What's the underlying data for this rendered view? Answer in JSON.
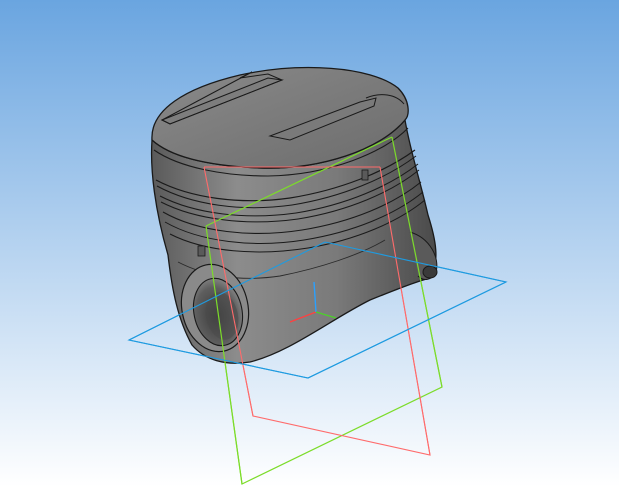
{
  "viewport": {
    "background_gradient": {
      "top": "#6aa5e0",
      "bottom": "#ffffff"
    },
    "view_mode": "shaded-with-edges"
  },
  "model": {
    "part": "piston",
    "body_color": "#6e6e6e",
    "edge_color": "#1a1a1a"
  },
  "reference_planes": {
    "front": {
      "color": "#ff6b6b"
    },
    "right": {
      "color": "#7cdc2a"
    },
    "top": {
      "color": "#1f9be0"
    }
  },
  "origin_axes": {
    "x_color": "#ff4040",
    "y_color": "#2aa0ff",
    "z_color": "#4cd02a"
  }
}
